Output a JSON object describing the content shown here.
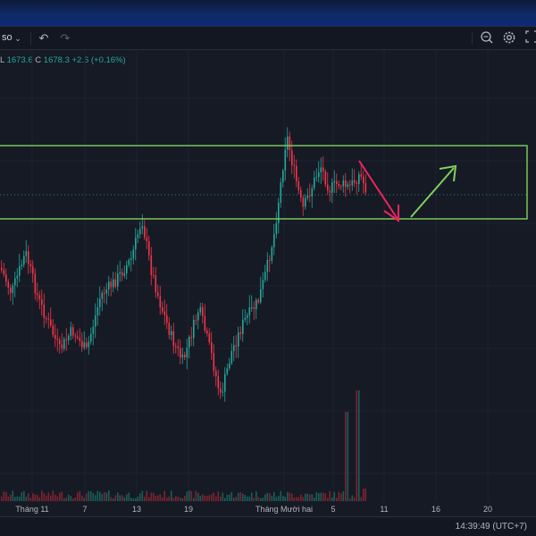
{
  "toolbar": {
    "symbol_fragment": "so",
    "chevron_icon": "chevron-down-icon",
    "undo_icon": "undo-icon",
    "redo_icon": "redo-icon",
    "zoom_icon": "zoom-icon",
    "settings_icon": "gear-icon",
    "fullscreen_icon": "fullscreen-icon"
  },
  "ohlc": {
    "low_label": "L",
    "low_value": "1673.6",
    "close_label": "C",
    "close_value": "1678.3",
    "change": "+2.6 (+0.16%)"
  },
  "chart_data": {
    "type": "candlestick",
    "x_ticks": [
      "Tháng 11",
      "7",
      "13",
      "19",
      "Tháng Mười hai",
      "5",
      "11",
      "16",
      "20"
    ],
    "up_color": "#26a69a",
    "down_color": "#f23645",
    "zone_color": "#7fd15e",
    "arrow_down_color": "#f0245f",
    "arrow_up_color": "#7fd15e",
    "grid": true,
    "annotations": [
      "horizontal-zone-rectangle",
      "down-arrow",
      "up-arrow"
    ]
  },
  "status": {
    "clock": "14:39:49 (UTC+7)"
  }
}
